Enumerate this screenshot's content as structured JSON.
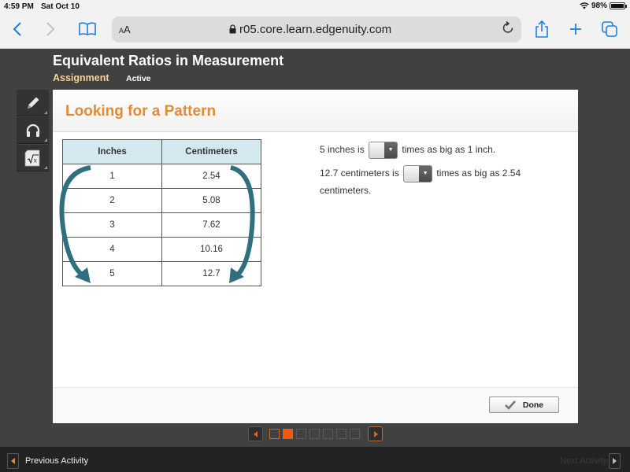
{
  "status_bar": {
    "time": "4:59 PM",
    "date": "Sat Oct 10",
    "battery": "98%",
    "battery_level": 0.98
  },
  "browser": {
    "text_size_label": "AA",
    "url": "r05.core.learn.edgenuity.com",
    "icons": [
      "back-icon",
      "forward-icon",
      "bookmarks-icon",
      "lock-icon",
      "reload-icon",
      "share-icon",
      "new-tab-icon",
      "tabs-icon"
    ]
  },
  "header": {
    "title": "Equivalent Ratios in Measurement",
    "tab_assignment": "Assignment",
    "tab_status": "Active"
  },
  "tools": [
    "pencil-icon",
    "headphones-icon",
    "math-sqrt-icon"
  ],
  "activity": {
    "title": "Looking for a Pattern",
    "table": {
      "headers": [
        "Inches",
        "Centimeters"
      ],
      "rows": [
        [
          "1",
          "2.54"
        ],
        [
          "2",
          "5.08"
        ],
        [
          "3",
          "7.62"
        ],
        [
          "4",
          "10.16"
        ],
        [
          "5",
          "12.7"
        ]
      ]
    },
    "questions": [
      {
        "before": "5 inches is",
        "after": "times as big as 1 inch.",
        "selected": ""
      },
      {
        "before": "12.7 centimeters is",
        "after": "times as big as 2.54 centimeters.",
        "selected": ""
      }
    ],
    "done_label": "Done"
  },
  "pager": {
    "total": 7,
    "current": 2
  },
  "colors": {
    "accent": "#e68a33",
    "pager_active": "#ee5a10",
    "arrow": "#2f6f80",
    "header_cell": "#d4e8ef"
  },
  "nav": {
    "previous": "Previous Activity",
    "next": "Next Activity"
  }
}
